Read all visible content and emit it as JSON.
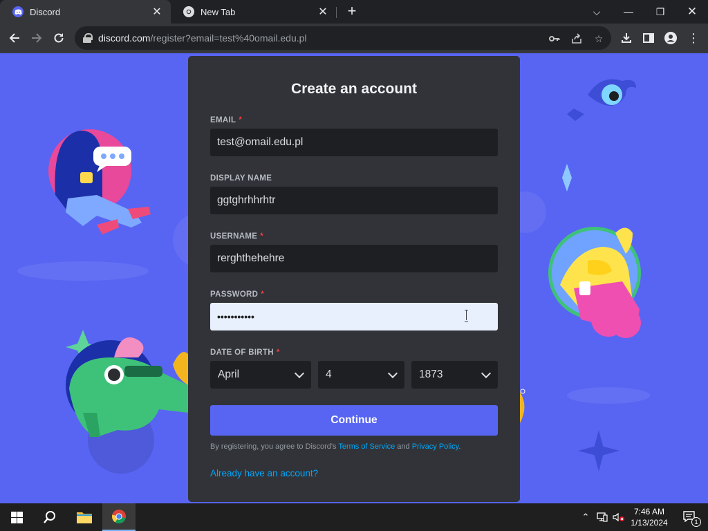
{
  "browser": {
    "tabs": [
      {
        "title": "Discord",
        "favicon": "discord-icon",
        "active": true
      },
      {
        "title": "New Tab",
        "favicon": "chrome-icon",
        "active": false
      }
    ],
    "url_host": "discord.com",
    "url_path": "/register?email=test%40omail.edu.pl"
  },
  "form": {
    "title": "Create an account",
    "email": {
      "label": "EMAIL",
      "required": "*",
      "value": "test@omail.edu.pl"
    },
    "display_name": {
      "label": "DISPLAY NAME",
      "value": "ggtghrhhrhtr"
    },
    "username": {
      "label": "USERNAME",
      "required": "*",
      "value": "rerghthehehre"
    },
    "password": {
      "label": "PASSWORD",
      "required": "*",
      "value": "•••••••••••"
    },
    "dob": {
      "label": "DATE OF BIRTH",
      "required": "*",
      "month": "April",
      "day": "4",
      "year": "1873"
    },
    "continue_label": "Continue",
    "legal_prefix": "By registering, you agree to Discord's ",
    "terms_label": "Terms of Service",
    "legal_and": " and ",
    "privacy_label": "Privacy Policy",
    "legal_suffix": ".",
    "login_link": "Already have an account?"
  },
  "taskbar": {
    "time": "7:46 AM",
    "date": "1/13/2024",
    "notification_count": "1"
  },
  "colors": {
    "blurple": "#5865f2",
    "card": "#313338",
    "input": "#1e1f22",
    "link": "#00a8fc",
    "required": "#f23f42"
  }
}
